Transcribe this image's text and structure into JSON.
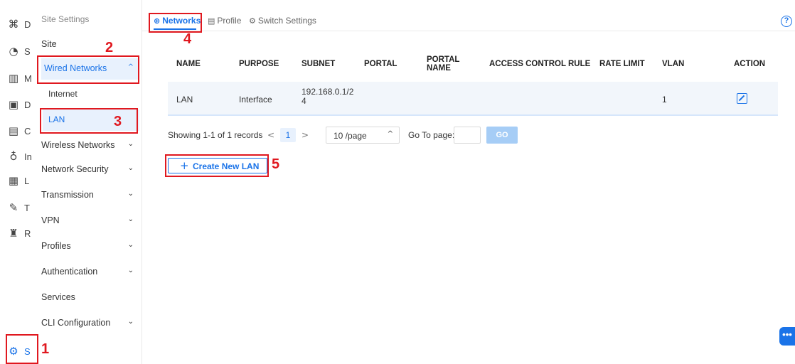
{
  "rail": {
    "items": [
      {
        "icon": "dashboard-icon",
        "glyph": "⌘",
        "letter": "D"
      },
      {
        "icon": "statistics-icon",
        "glyph": "◔",
        "letter": "S"
      },
      {
        "icon": "map-icon",
        "glyph": "▥",
        "letter": "M"
      },
      {
        "icon": "devices-icon",
        "glyph": "▣",
        "letter": "D"
      },
      {
        "icon": "clients-icon",
        "glyph": "▤",
        "letter": "C"
      },
      {
        "icon": "insights-icon",
        "glyph": "♁",
        "letter": "In"
      },
      {
        "icon": "logs-icon",
        "glyph": "▦",
        "letter": "L"
      },
      {
        "icon": "tools-icon",
        "glyph": "✎",
        "letter": "T"
      },
      {
        "icon": "reports-icon",
        "glyph": "♜",
        "letter": "R"
      },
      {
        "icon": "settings-icon",
        "glyph": "⚙",
        "letter": "S"
      }
    ]
  },
  "submenu": {
    "header": "Site Settings",
    "site": "Site",
    "wired_networks": "Wired Networks",
    "wired_chevron": "^",
    "internet": "Internet",
    "lan": "LAN",
    "wireless_networks": "Wireless Networks",
    "network_security": "Network Security",
    "transmission": "Transmission",
    "vpn": "VPN",
    "profiles": "Profiles",
    "authentication": "Authentication",
    "services": "Services",
    "cli_configuration": "CLI Configuration",
    "chevron": "⌄"
  },
  "tabs": {
    "networks": "Networks",
    "profile": "Profile",
    "switch_settings": "Switch Settings"
  },
  "table": {
    "headers": {
      "name": "NAME",
      "purpose": "PURPOSE",
      "subnet": "SUBNET",
      "portal": "PORTAL",
      "portal_name_1": "PORTAL",
      "portal_name_2": "NAME",
      "access_control_rule": "ACCESS CONTROL RULE",
      "rate_limit": "RATE LIMIT",
      "vlan": "VLAN",
      "action": "ACTION"
    },
    "rows": [
      {
        "name": "LAN",
        "purpose": "Interface",
        "subnet_1": "192.168.0.1/2",
        "subnet_2": "4",
        "vlan": "1"
      }
    ]
  },
  "pager": {
    "showing": "Showing 1-1 of 1 records",
    "prev": "<",
    "page": "1",
    "next": ">",
    "per_page": "10 /page",
    "per_page_chevron": "^",
    "goto_label": "Go To page:",
    "goto_value": "",
    "go": "GO"
  },
  "create_button": {
    "plus": "+",
    "label": "Create New LAN"
  },
  "annotations": [
    "1",
    "2",
    "3",
    "4",
    "5"
  ],
  "help": "?",
  "chat": "•••",
  "colors": {
    "accent": "#1a73e8",
    "highlight": "#e0181f"
  }
}
